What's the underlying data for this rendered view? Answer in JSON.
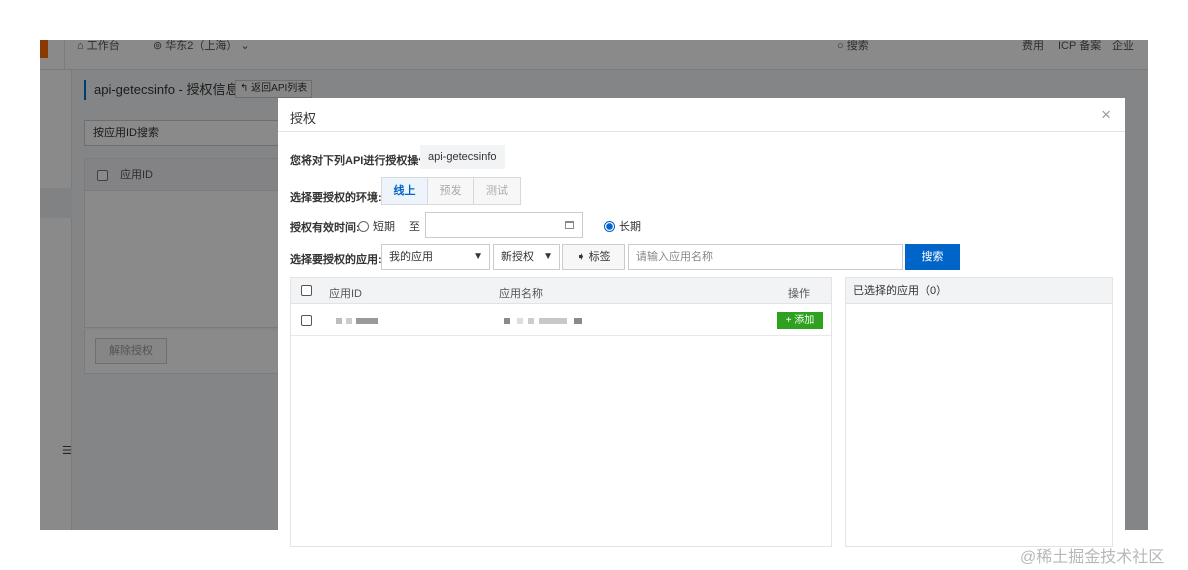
{
  "topbar": {
    "workbench_label": "工作台",
    "region_label": "华东2（上海）",
    "search_placeholder": "搜索",
    "links": [
      "费用",
      "ICP 备案",
      "企业"
    ]
  },
  "background": {
    "title": "api-getecsinfo - 授权信息",
    "back_button": "返回API列表",
    "search_label": "按应用ID搜索",
    "table_header": "应用ID",
    "revoke_button": "解除授权"
  },
  "modal": {
    "title": "授权",
    "close_symbol": "×",
    "api_prompt": "您将对下列API进行授权操作:",
    "api_name": "api-getecsinfo",
    "env_label": "选择要授权的环境:",
    "env_tabs": [
      "线上",
      "预发",
      "测试"
    ],
    "env_active": "线上",
    "validity_label": "授权有效时间:",
    "short_term": "短期",
    "to_label": "至",
    "long_term": "长期",
    "validity_selected": "长期",
    "app_label": "选择要授权的应用:",
    "app_scope_select": "我的应用",
    "auth_select": "新授权",
    "tag_button": "标签",
    "app_search_placeholder": "请输入应用名称",
    "search_button": "搜索",
    "list_headers": {
      "app_id": "应用ID",
      "app_name": "应用名称",
      "action": "操作"
    },
    "add_button": "+ 添加",
    "selected_header": "已选择的应用（0）"
  },
  "watermark": "@稀土掘金技术社区"
}
